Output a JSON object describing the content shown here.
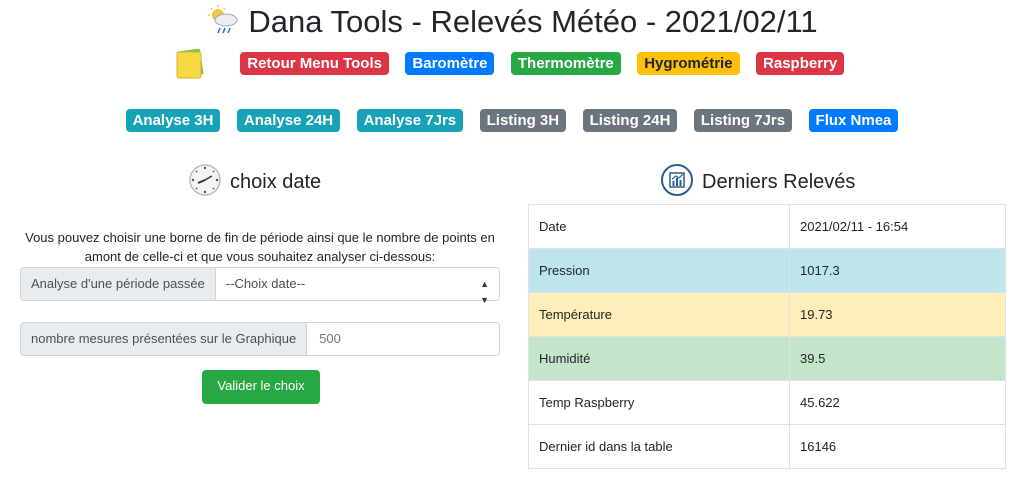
{
  "header": {
    "title": "Dana Tools - Relevés Météo - 2021/02/11"
  },
  "nav1": [
    "Retour Menu Tools",
    "Baromètre",
    "Thermomètre",
    "Hygrométrie",
    "Raspberry"
  ],
  "nav2": [
    "Analyse 3H",
    "Analyse 24H",
    "Analyse 7Jrs",
    "Listing 3H",
    "Listing 24H",
    "Listing 7Jrs",
    "Flux Nmea"
  ],
  "left": {
    "title": "choix date",
    "description": "Vous pouvez choisir une borne de fin de période ainsi que le nombre de points en amont de celle-ci et que vous souhaitez analyser ci-dessous:",
    "period_label": "Analyse d'une période passée",
    "period_select": "--Choix date--",
    "count_label": "nombre mesures présentées sur le Graphique",
    "count_placeholder": "500",
    "submit": "Valider le choix"
  },
  "right": {
    "title": "Derniers Relevés",
    "rows": [
      {
        "label": "Date",
        "value": "2021/02/11 - 16:54"
      },
      {
        "label": "Pression",
        "value": "1017.3"
      },
      {
        "label": "Température",
        "value": "19.73"
      },
      {
        "label": "Humidité",
        "value": "39.5"
      },
      {
        "label": "Temp Raspberry",
        "value": "45.622"
      },
      {
        "label": "Dernier id dans la table",
        "value": "16146"
      }
    ]
  },
  "colors": {
    "red": "#dc3545",
    "blue": "#007bff",
    "green": "#28a745",
    "yellow": "#ffc107",
    "teal": "#17a2b8",
    "gray": "#6c757d"
  }
}
